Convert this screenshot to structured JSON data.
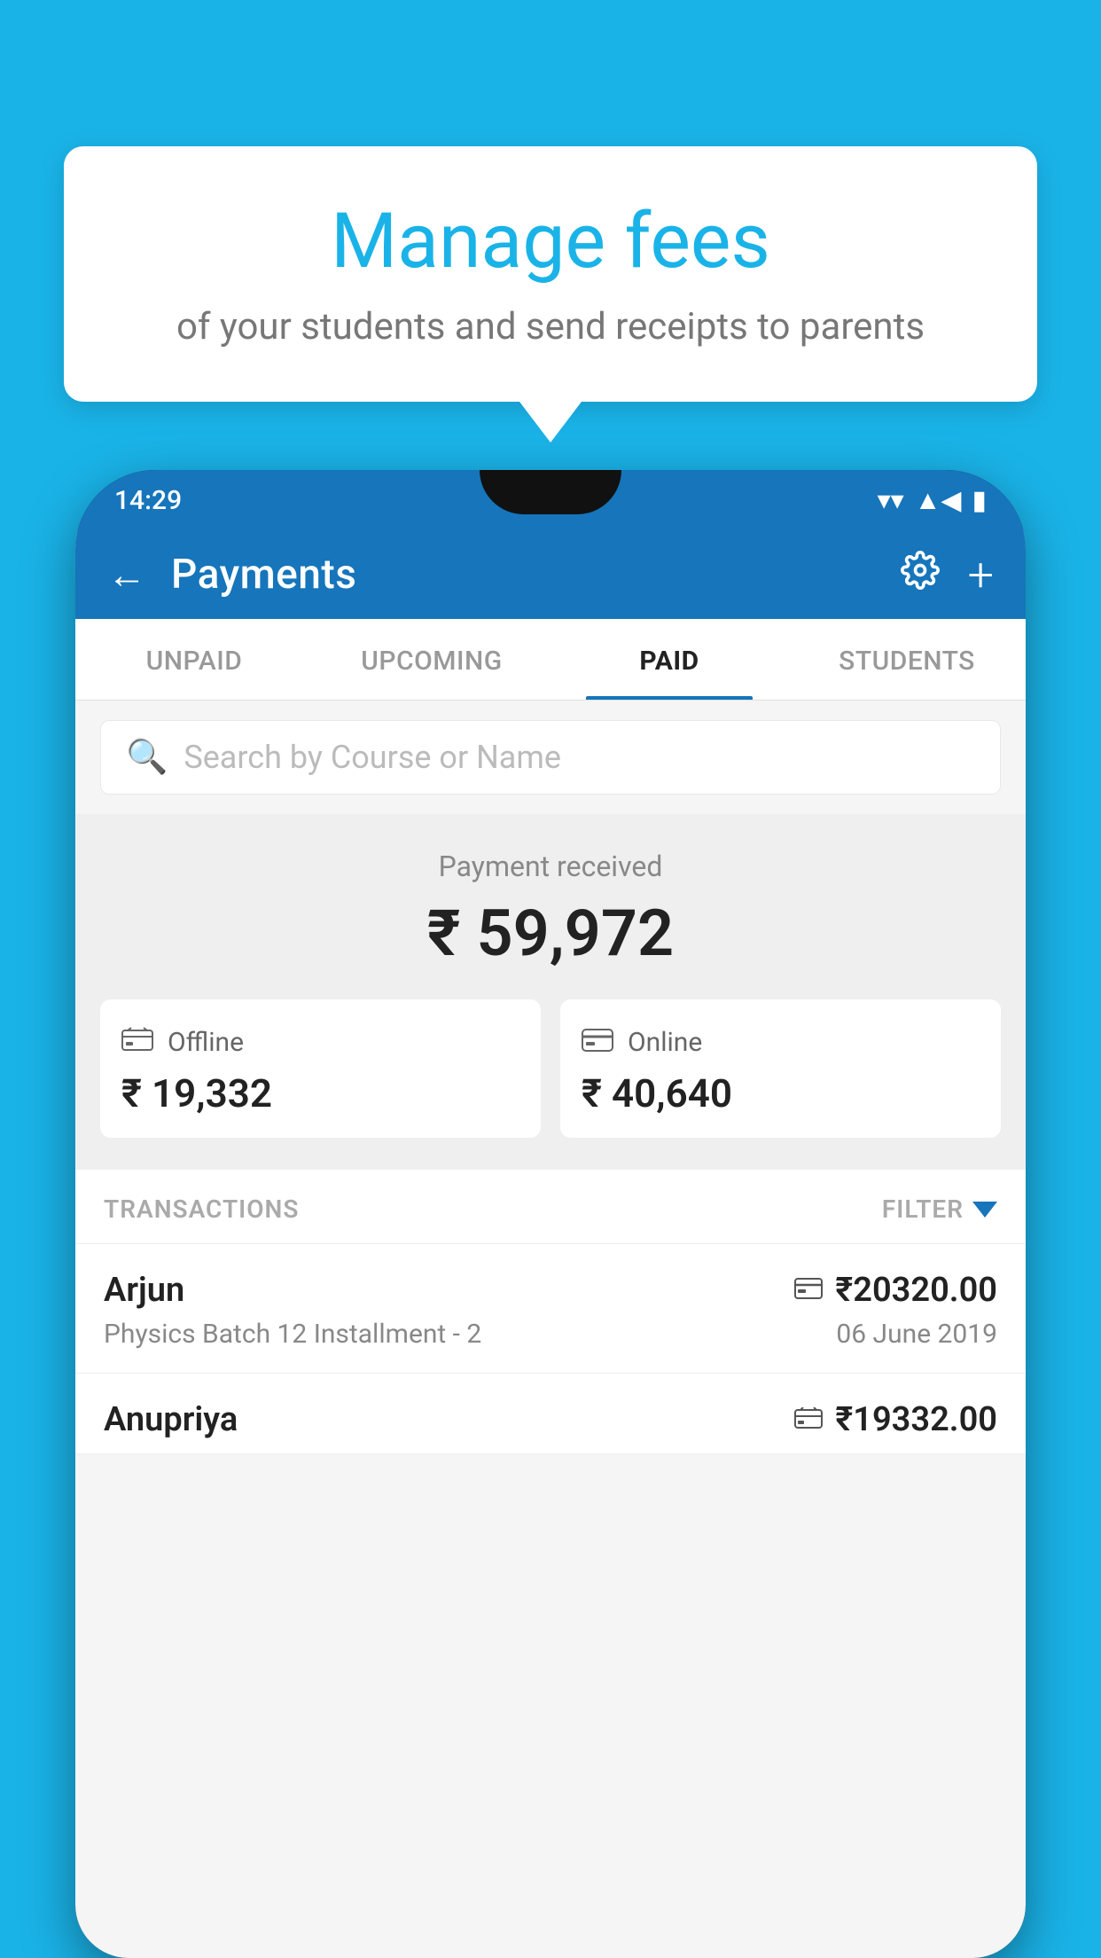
{
  "tooltip": {
    "title": "Manage fees",
    "subtitle": "of your students and send receipts to parents"
  },
  "status_bar": {
    "time": "14:29",
    "wifi": "▼",
    "signal": "▲",
    "battery": "▮"
  },
  "header": {
    "title": "Payments",
    "back_label": "←",
    "plus_label": "+"
  },
  "tabs": [
    {
      "label": "UNPAID",
      "active": false
    },
    {
      "label": "UPCOMING",
      "active": false
    },
    {
      "label": "PAID",
      "active": true
    },
    {
      "label": "STUDENTS",
      "active": false
    }
  ],
  "search": {
    "placeholder": "Search by Course or Name"
  },
  "payment_received": {
    "label": "Payment received",
    "amount": "₹ 59,972",
    "offline": {
      "label": "Offline",
      "amount": "₹ 19,332"
    },
    "online": {
      "label": "Online",
      "amount": "₹ 40,640"
    }
  },
  "transactions": {
    "header_label": "TRANSACTIONS",
    "filter_label": "FILTER",
    "rows": [
      {
        "name": "Arjun",
        "amount": "₹20320.00",
        "course": "Physics Batch 12 Installment - 2",
        "date": "06 June 2019",
        "payment_type": "online"
      },
      {
        "name": "Anupriya",
        "amount": "₹19332.00",
        "course": "",
        "date": "",
        "payment_type": "offline"
      }
    ]
  },
  "colors": {
    "primary": "#1675bb",
    "background": "#1ab3e8",
    "white": "#ffffff",
    "light_gray": "#f5f5f5"
  }
}
